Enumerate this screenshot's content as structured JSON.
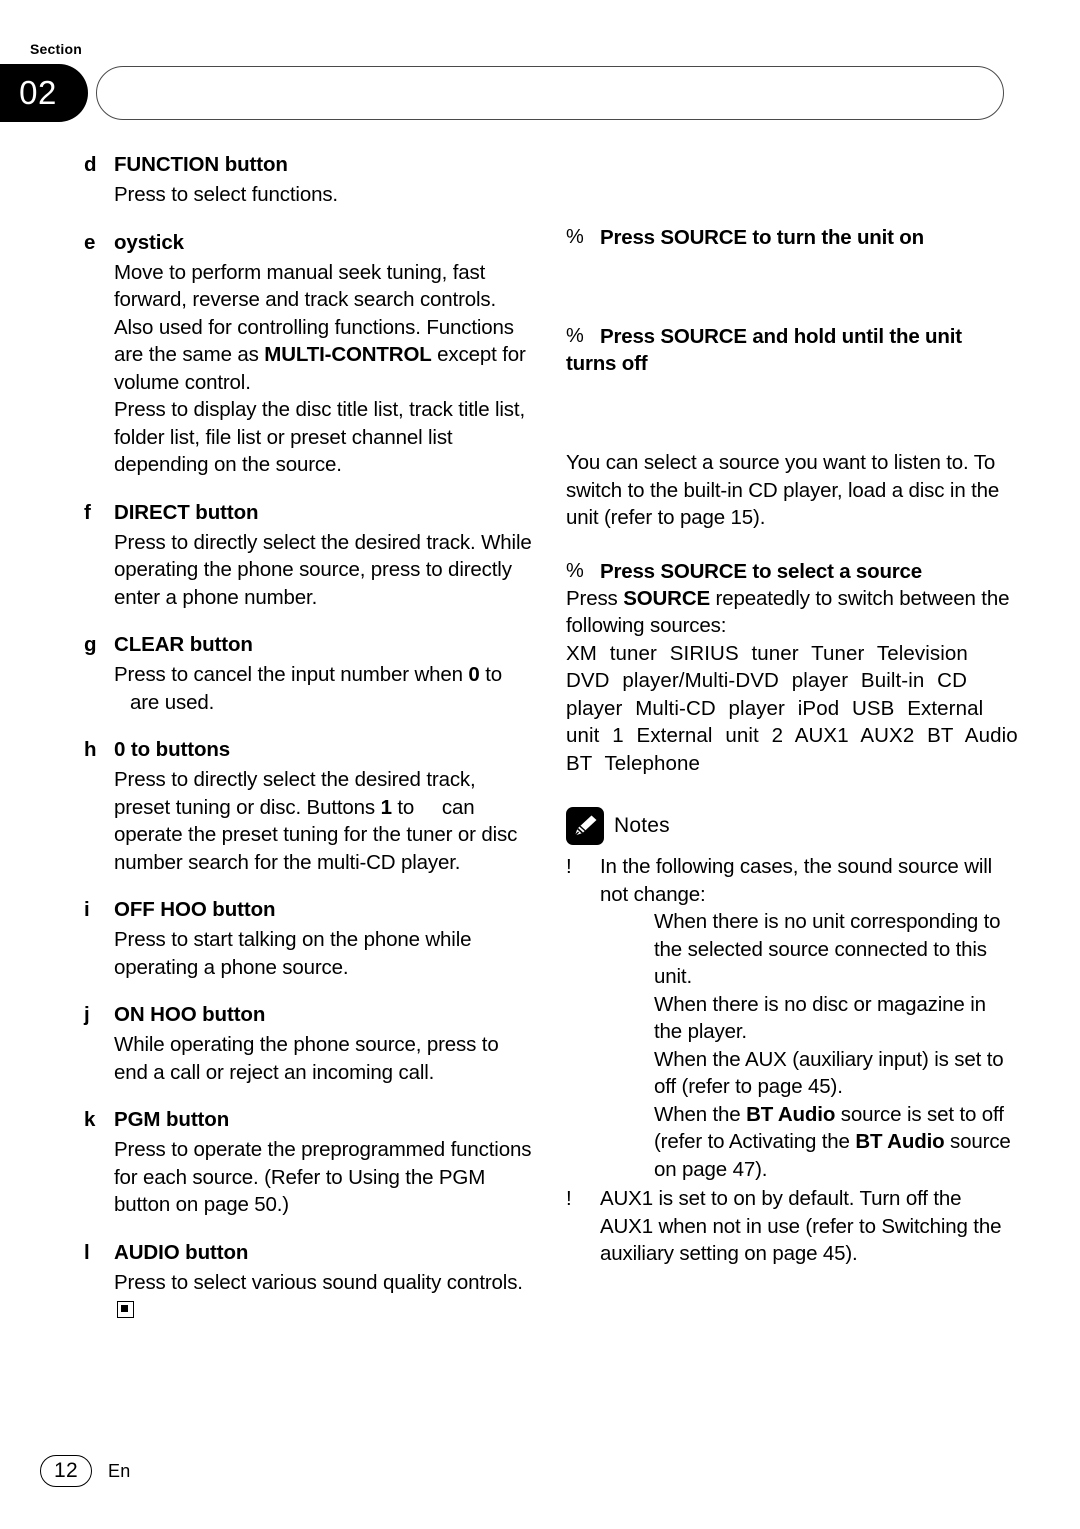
{
  "header": {
    "section_label": "Section",
    "section_number": "02",
    "title_bar_text": ""
  },
  "left_column": {
    "items": [
      {
        "letter": "d",
        "title": "FUNCTION button",
        "body_html": "Press to select functions."
      },
      {
        "letter": "e",
        "title": "oystick",
        "body_html": "Move to perform manual seek tuning, fast forward, reverse and track search controls. Also used for controlling functions. Functions are the same as <b class=\"inline\">MULTI-CONTROL</b> except for volume control.<br>Press to display the disc title list, track title list, folder list, file list or preset channel list depending on the source."
      },
      {
        "letter": "f",
        "title": "DIRECT button",
        "body_html": "Press to directly select the desired track. While operating the phone source, press to directly enter a phone number."
      },
      {
        "letter": "g",
        "title": "CLEAR button",
        "body_html": "Press to cancel the input number when <b class=\"inline\">0</b> to <span class=\"hang\">are used.</span>"
      },
      {
        "letter": "h",
        "title": "0 to  buttons",
        "body_html": "Press to directly select the desired track, preset tuning or disc. Buttons <b class=\"inline\">1</b> to&nbsp;&nbsp;&nbsp;&nbsp; can operate the preset tuning for the tuner or disc number search for the multi-CD player."
      },
      {
        "letter": "i",
        "title": "OFF HOO  button",
        "body_html": "Press to start talking on the phone while operating a phone source."
      },
      {
        "letter": "j",
        "title": "ON HOO  button",
        "body_html": "While operating the phone source, press to end a call or reject an incoming call."
      },
      {
        "letter": "k",
        "title": "PGM button",
        "body_html": "Press to operate the preprogrammed functions for each source. (Refer to Using the PGM button on page 50.)"
      },
      {
        "letter": "l",
        "title": "AUDIO button",
        "body_html": "Press to select various sound quality controls.<span class=\"end-marker\"></span>"
      }
    ]
  },
  "right_column": {
    "action_power_on": {
      "marker": "%",
      "text": "Press SOURCE to turn the unit on"
    },
    "action_power_off": {
      "marker": "%",
      "text": "Press SOURCE and hold until the unit",
      "text_line2": "turns off"
    },
    "intro_paragraph": "You can select a source you want to listen to. To switch to the built-in CD player, load a disc in the unit (refer to page 15).",
    "action_select_source": {
      "marker": "%",
      "text": "Press SOURCE to select a source"
    },
    "select_source_body_html": "Press <b class=\"inline\">SOURCE</b> repeatedly to switch between the following sources:",
    "sources_text": "XM tuner   SIRIUS tuner   Tuner   Television   DVD player/Multi-DVD player   Built-in CD player   Multi-CD player   iPod   USB   External unit 1   External unit 2   AUX1   AUX2   BT Audio   BT Telephone",
    "notes": {
      "icon": "pencil-icon",
      "title": "Notes",
      "items": [
        {
          "marker": "!",
          "body_html": "In the following cases, the sound source will not change:<span class=\"note-sub\">When there is no unit corresponding to the selected source connected to this unit.</span><span class=\"note-sub\">When there is no disc or magazine in the player.</span><span class=\"note-sub\">When the AUX (auxiliary input) is set to off (refer to page 45).</span><span class=\"note-sub\">When the <b class=\"inline\">BT Audio</b> source is set to off (refer to Activating the <b class=\"inline\">BT Audio</b> source on page 47).</span>"
        },
        {
          "marker": "!",
          "body_html": "AUX1 is set to on by default. Turn off the AUX1 when not in use (refer to Switching the auxiliary setting on page 45)."
        }
      ]
    }
  },
  "footer": {
    "page_number": "12",
    "language": "En"
  }
}
